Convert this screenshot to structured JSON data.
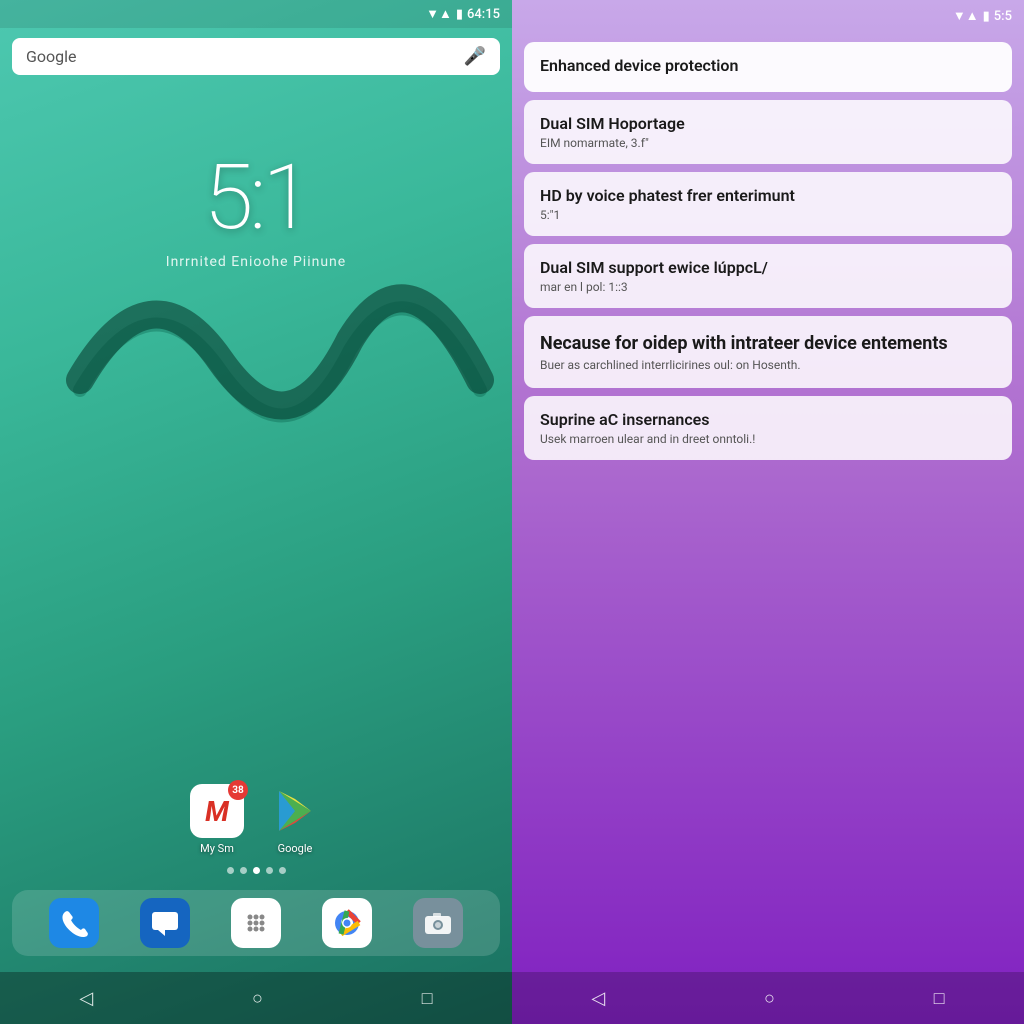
{
  "left": {
    "status_bar": {
      "time": "64:15",
      "signal_icon": "▼",
      "wifi_icon": "▲",
      "battery_icon": "🔋"
    },
    "search": {
      "placeholder": "Google",
      "mic_label": "mic"
    },
    "clock": {
      "time": "5:1",
      "subtitle": "Inrrnited Enioohe Piinune"
    },
    "apps": [
      {
        "name": "My Sm",
        "badge": "38",
        "type": "gmail"
      }
    ],
    "dock_apps": [
      {
        "name": "Phone",
        "type": "phone"
      },
      {
        "name": "Messages",
        "type": "messages"
      },
      {
        "name": "Apps",
        "type": "apps"
      },
      {
        "name": "Chrome",
        "type": "chrome"
      },
      {
        "name": "Camera",
        "type": "camera"
      }
    ],
    "google_label": "Google",
    "nav": {
      "back": "◁",
      "home": "○",
      "recent": "□"
    }
  },
  "right": {
    "status_bar": {
      "time": "5:5",
      "signal_icon": "▼",
      "wifi_icon": "▲",
      "battery_icon": "🔋"
    },
    "features": [
      {
        "id": "card1",
        "title": "Enhanced device protection",
        "subtitle": "",
        "large": false,
        "highlighted": true
      },
      {
        "id": "card2",
        "title": "Dual SIM Hoportage",
        "subtitle": "EIM nomarmate, 3.f\"",
        "large": false,
        "highlighted": false
      },
      {
        "id": "card3",
        "title": "HD by voice phatest frer enterimunt",
        "subtitle": "5:\"1",
        "large": false,
        "highlighted": false
      },
      {
        "id": "card4",
        "title": "Dual SIM support ewice lúppcL/",
        "subtitle": "mar en l pol: 1::3",
        "large": false,
        "highlighted": false
      },
      {
        "id": "card5",
        "title": "Necause for oidep with intrateer device entements",
        "subtitle": "Buer as carchlined interrlicirines oul: on Hosenth.",
        "large": true,
        "highlighted": false
      },
      {
        "id": "card6",
        "title": "Suprine aC insernances",
        "subtitle": "Usek marroen ulear and in dreet onntoli.!",
        "large": false,
        "highlighted": false
      }
    ],
    "nav": {
      "back": "◁",
      "home": "○",
      "recent": "□"
    }
  }
}
